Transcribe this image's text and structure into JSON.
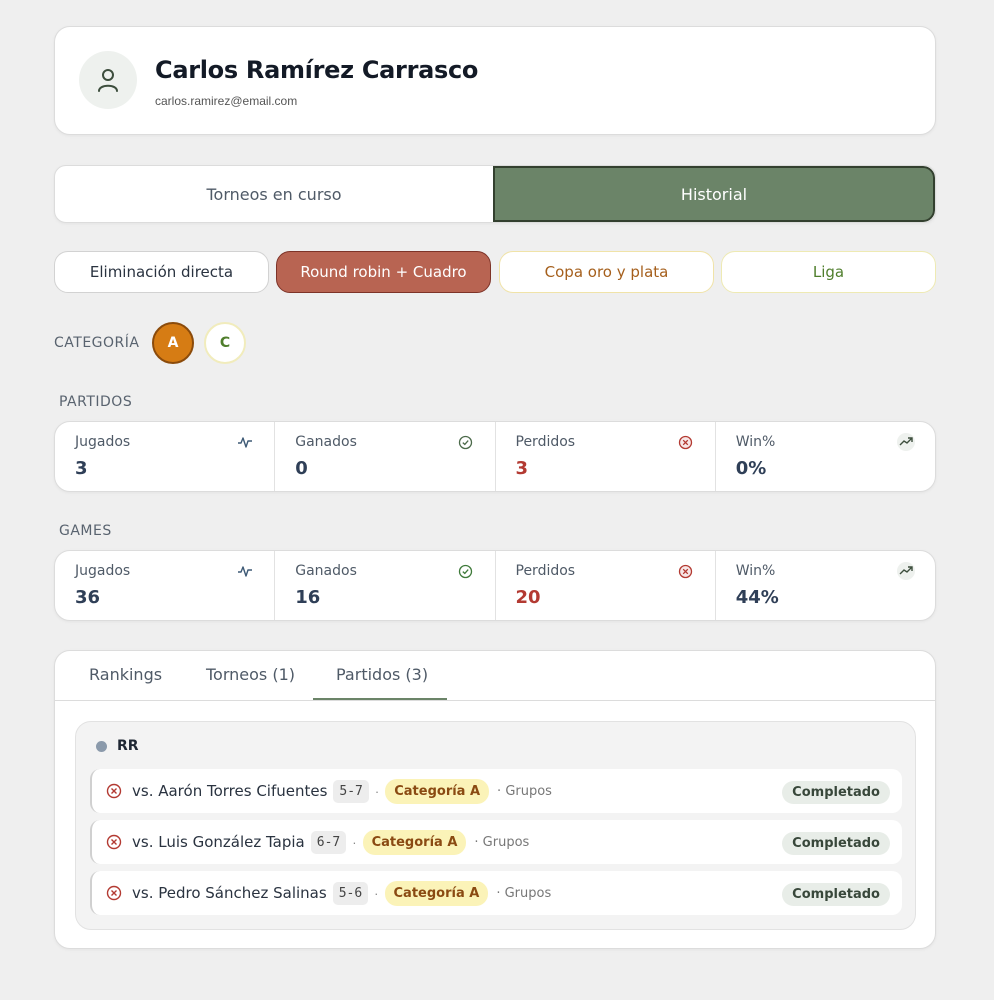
{
  "profile": {
    "name": "Carlos Ramírez Carrasco",
    "email": "carlos.ramirez@email.com",
    "avatar_icon": "user-icon"
  },
  "main_tabs": [
    {
      "label": "Torneos en curso",
      "active": false
    },
    {
      "label": "Historial",
      "active": true
    }
  ],
  "formats": [
    {
      "label": "Eliminación directa",
      "active": false
    },
    {
      "label": "Round robin + Cuadro",
      "active": true
    },
    {
      "label": "Copa oro y plata",
      "active": false
    },
    {
      "label": "Liga",
      "active": false
    }
  ],
  "category": {
    "label": "CATEGORÍA",
    "options": [
      {
        "label": "A",
        "active": true
      },
      {
        "label": "C",
        "active": false
      }
    ]
  },
  "partidos": {
    "label": "PARTIDOS",
    "stats": [
      {
        "label": "Jugados",
        "value": "3",
        "icon": "activity-icon"
      },
      {
        "label": "Ganados",
        "value": "0",
        "icon": "check-circle-icon"
      },
      {
        "label": "Perdidos",
        "value": "3",
        "icon": "x-circle-icon"
      },
      {
        "label": "Win%",
        "value": "0%",
        "icon": "trending-up-icon"
      }
    ]
  },
  "games": {
    "label": "GAMES",
    "stats": [
      {
        "label": "Jugados",
        "value": "36",
        "icon": "activity-icon"
      },
      {
        "label": "Ganados",
        "value": "16",
        "icon": "check-circle-icon"
      },
      {
        "label": "Perdidos",
        "value": "20",
        "icon": "x-circle-icon"
      },
      {
        "label": "Win%",
        "value": "44%",
        "icon": "trending-up-icon"
      }
    ]
  },
  "sub_tabs": [
    {
      "label": "Rankings",
      "active": false
    },
    {
      "label": "Torneos (1)",
      "active": false
    },
    {
      "label": "Partidos (3)",
      "active": true
    }
  ],
  "group": {
    "title": "RR",
    "matches": [
      {
        "opponent": "vs. Aarón Torres Cifuentes",
        "score": "5-7",
        "category": "Categoría A",
        "phase": "Grupos",
        "status": "Completado"
      },
      {
        "opponent": "vs. Luis González Tapia",
        "score": "6-7",
        "category": "Categoría A",
        "phase": "Grupos",
        "status": "Completado"
      },
      {
        "opponent": "vs. Pedro Sánchez Salinas",
        "score": "5-6",
        "category": "Categoría A",
        "phase": "Grupos",
        "status": "Completado"
      }
    ]
  },
  "colors": {
    "accent": "#6b8468",
    "rr_active": "#b86452",
    "category_active": "#d67c14",
    "loss_red": "#b33a32"
  }
}
